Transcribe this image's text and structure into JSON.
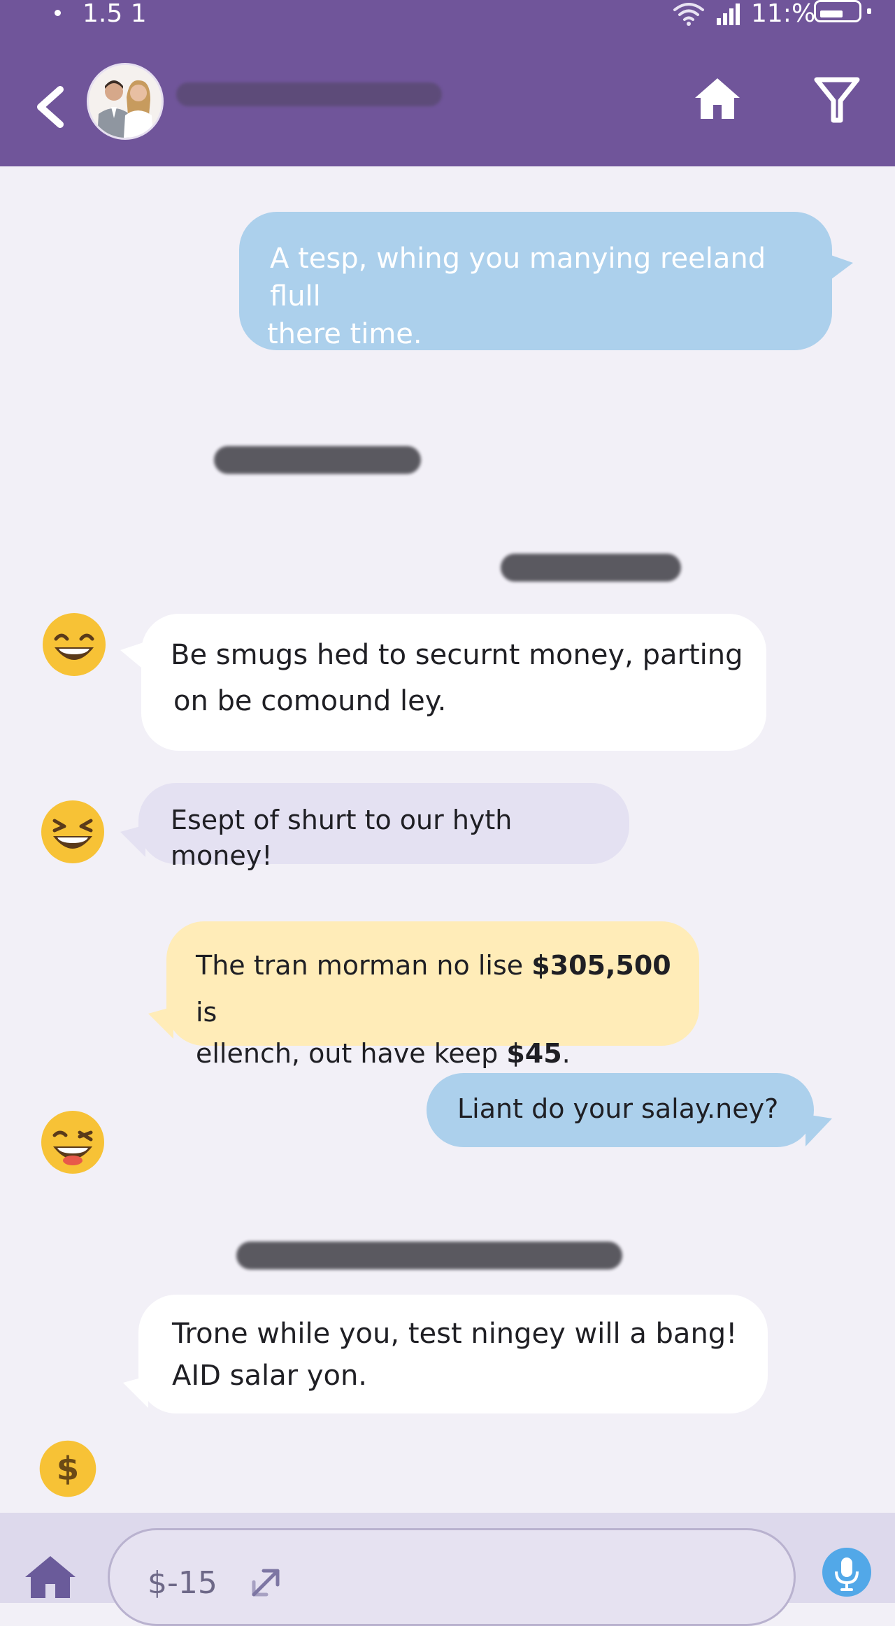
{
  "status_bar": {
    "time": "1.5 1",
    "battery_text": "11:%"
  },
  "header": {
    "back_icon": "chevron-left-icon",
    "home_icon": "home-icon",
    "filter_icon": "filter-icon",
    "colors": {
      "bar": "#70559a",
      "icons": "#ffffff"
    }
  },
  "messages": [
    {
      "id": "m1",
      "side": "right",
      "color": "blue",
      "lines": [
        "A tesp, whing you manying reeland flull",
        "there time."
      ]
    },
    {
      "id": "m2",
      "side": "left",
      "color": "white",
      "emoji": "grinning-face",
      "lines": [
        "Be smugs hed to securnt money, parting",
        "on be comound ley."
      ]
    },
    {
      "id": "m3",
      "side": "left",
      "color": "lavender",
      "emoji": "squinting-face",
      "lines": [
        "Esept of shurt to our hyth money!"
      ]
    },
    {
      "id": "m4",
      "side": "left",
      "color": "yellow",
      "line1_pre": "The tran morman no lise ",
      "line1_bold": "$305,500",
      "line1_post": " is",
      "line2_pre": "ellench, out have keep ",
      "line2_bold": "$45",
      "line2_post": "."
    },
    {
      "id": "m5",
      "side": "right",
      "color": "blue",
      "emoji": "winking-face",
      "lines": [
        "Liant do your salay.ney?"
      ]
    },
    {
      "id": "m6",
      "side": "left",
      "color": "white",
      "lines": [
        "Trone while you, test ningey will a bang!",
        "AID salar yon."
      ]
    }
  ],
  "bottom_bar": {
    "home_icon": "home-icon",
    "input_value": "$-15",
    "expand_icon": "expand-arrow-icon",
    "mic_icon": "microphone-icon",
    "emoji": "money-face"
  }
}
